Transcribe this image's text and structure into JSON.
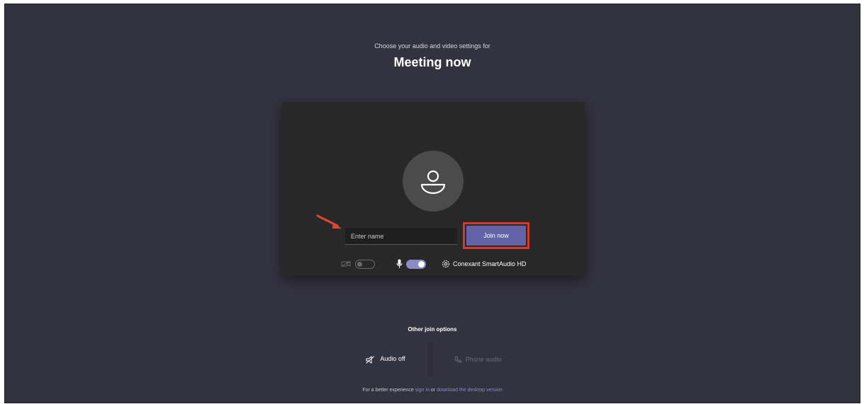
{
  "header": {
    "subtitle": "Choose your audio and video settings for",
    "meeting_title": "Meeting now"
  },
  "prejoin": {
    "name_placeholder": "Enter name",
    "join_label": "Join now",
    "camera_toggle": "off",
    "mic_toggle": "on",
    "device_name": "Conexant SmartAudio HD"
  },
  "other_options": {
    "heading": "Other join options",
    "audio_off_label": "Audio off",
    "phone_audio_label": "Phone audio"
  },
  "footer": {
    "prefix": "For a better experience ",
    "sign_in": "sign in",
    "or_text": " or ",
    "download": "download the desktop version"
  },
  "colors": {
    "background": "#33323f",
    "preview_bg": "#282828",
    "accent": "#6264a7",
    "highlight": "#d9382a"
  }
}
